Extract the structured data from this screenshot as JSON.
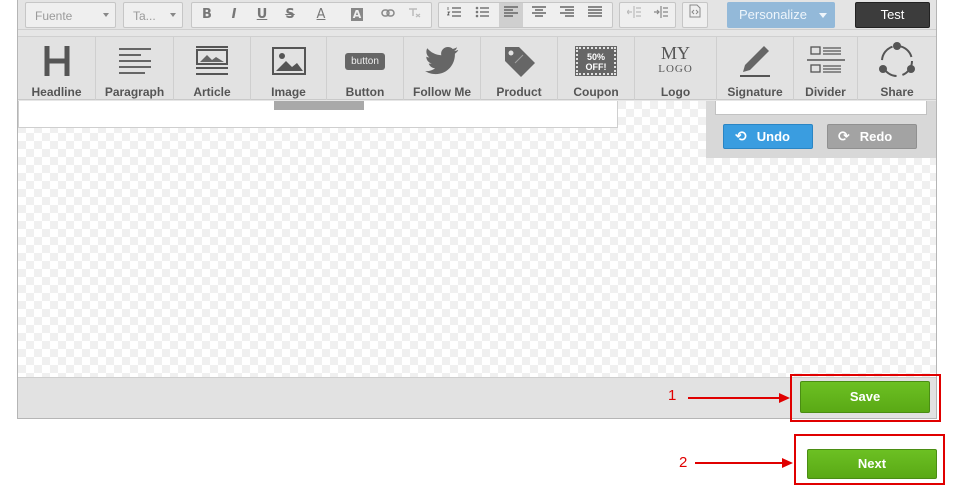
{
  "toolbar": {
    "font_select": "Fuente",
    "size_select": "Ta...",
    "bold": "B",
    "italic": "I",
    "underline": "U",
    "strike": "S",
    "font_color": "A",
    "bg_color": "A",
    "personalize": "Personalize",
    "test": "Test"
  },
  "blocks": [
    {
      "label": "Headline",
      "icon": "headline-icon"
    },
    {
      "label": "Paragraph",
      "icon": "paragraph-icon"
    },
    {
      "label": "Article",
      "icon": "article-icon"
    },
    {
      "label": "Image",
      "icon": "image-icon"
    },
    {
      "label": "Button",
      "icon": "button-icon"
    },
    {
      "label": "Follow Me",
      "icon": "twitter-bird-icon"
    },
    {
      "label": "Product",
      "icon": "price-tag-icon"
    },
    {
      "label": "Coupon",
      "icon": "coupon-icon"
    },
    {
      "label": "Logo",
      "icon": "logo-icon"
    },
    {
      "label": "Signature",
      "icon": "pen-icon"
    },
    {
      "label": "Divider",
      "icon": "divider-icon"
    },
    {
      "label": "Share",
      "icon": "share-icon"
    }
  ],
  "block_icon_text": {
    "button": "button",
    "coupon_line1": "50%",
    "coupon_line2": "OFF!",
    "logo_line1": "MY",
    "logo_line2": "LOGO"
  },
  "panel": {
    "undo": "Undo",
    "redo": "Redo"
  },
  "actions": {
    "save": "Save",
    "next": "Next"
  },
  "callouts": {
    "one": "1",
    "two": "2"
  },
  "colors": {
    "accent_green": "#5aa915",
    "undo_blue": "#3a9de0",
    "highlight_red": "#e00000",
    "personalize_blue": "#93b9d9"
  }
}
